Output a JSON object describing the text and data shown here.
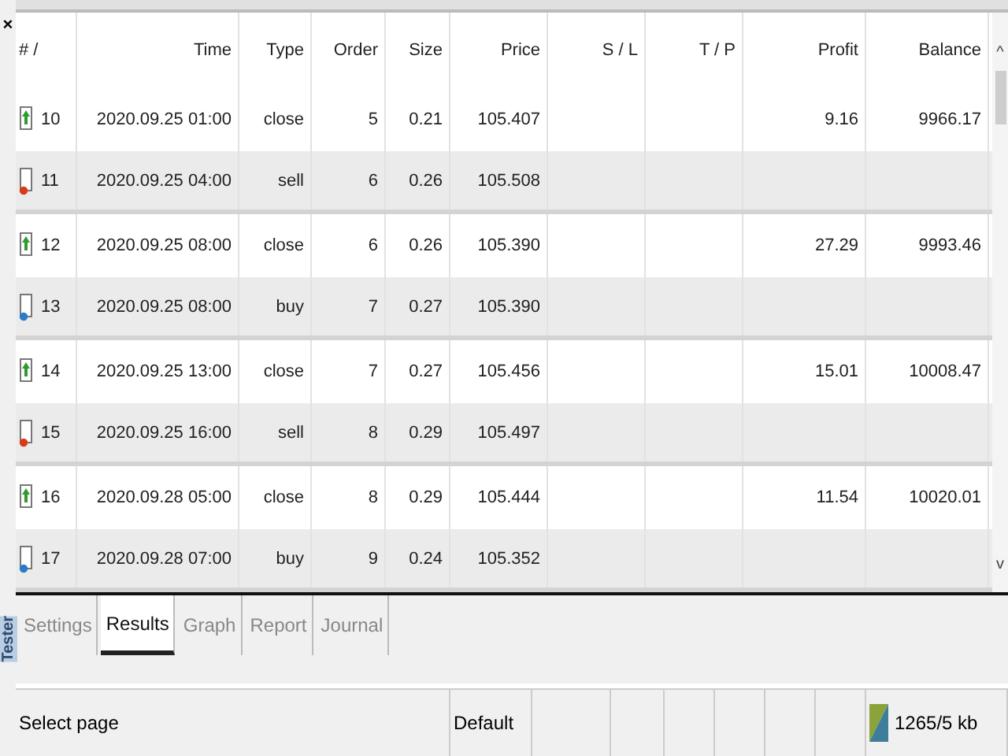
{
  "panel": {
    "close": "×",
    "title": "Tester"
  },
  "table": {
    "columns": [
      "# /",
      "Time",
      "Type",
      "Order",
      "Size",
      "Price",
      "S / L",
      "T / P",
      "Profit",
      "Balance"
    ],
    "rows": [
      {
        "kind": "close",
        "cells": [
          "10",
          "2020.09.25 01:00",
          "close",
          "5",
          "0.21",
          "105.407",
          "",
          "",
          "9.16",
          "9966.17"
        ]
      },
      {
        "kind": "sell",
        "cells": [
          "11",
          "2020.09.25 04:00",
          "sell",
          "6",
          "0.26",
          "105.508",
          "",
          "",
          "",
          ""
        ]
      },
      {
        "kind": "close",
        "cells": [
          "12",
          "2020.09.25 08:00",
          "close",
          "6",
          "0.26",
          "105.390",
          "",
          "",
          "27.29",
          "9993.46"
        ]
      },
      {
        "kind": "buy",
        "cells": [
          "13",
          "2020.09.25 08:00",
          "buy",
          "7",
          "0.27",
          "105.390",
          "",
          "",
          "",
          ""
        ]
      },
      {
        "kind": "close",
        "cells": [
          "14",
          "2020.09.25 13:00",
          "close",
          "7",
          "0.27",
          "105.456",
          "",
          "",
          "15.01",
          "10008.47"
        ]
      },
      {
        "kind": "sell",
        "cells": [
          "15",
          "2020.09.25 16:00",
          "sell",
          "8",
          "0.29",
          "105.497",
          "",
          "",
          "",
          ""
        ]
      },
      {
        "kind": "close",
        "cells": [
          "16",
          "2020.09.28 05:00",
          "close",
          "8",
          "0.29",
          "105.444",
          "",
          "",
          "11.54",
          "10020.01"
        ]
      },
      {
        "kind": "buy",
        "cells": [
          "17",
          "2020.09.28 07:00",
          "buy",
          "9",
          "0.24",
          "105.352",
          "",
          "",
          "",
          ""
        ]
      }
    ]
  },
  "scrollbar": {
    "up": "^",
    "down": "v"
  },
  "tabs": [
    {
      "label": "Settings",
      "selected": false
    },
    {
      "label": "Results",
      "selected": true
    },
    {
      "label": "Graph",
      "selected": false
    },
    {
      "label": "Report",
      "selected": false
    },
    {
      "label": "Journal",
      "selected": false
    }
  ],
  "status_bar": {
    "hint": "Select page",
    "profile": "Default",
    "memory": "1265/5 kb"
  }
}
